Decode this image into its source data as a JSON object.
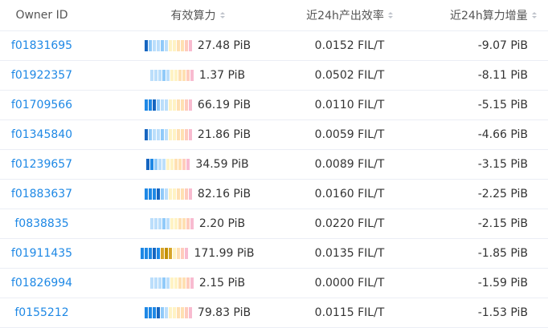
{
  "columns": {
    "owner_id": "Owner ID",
    "power": "有效算力",
    "efficiency": "近24h产出效率",
    "increase": "近24h算力增量"
  },
  "colors": {
    "link": "#1e88e5",
    "bar_palette": [
      "#1565c0",
      "#1e88e5",
      "#90caf9",
      "#bbdefb",
      "#fff3c4",
      "#ffe0b2",
      "#ffccbc",
      "#f8bbd0",
      "#e1bee7",
      "#d7a52a",
      "#c49000"
    ]
  },
  "rows": [
    {
      "owner_id": "f01831695",
      "power": "27.48 PiB",
      "efficiency": "0.0152 FIL/T",
      "increase": "-9.07 PiB",
      "bar": [
        0,
        2,
        3,
        3,
        2,
        3,
        4,
        4,
        5,
        5,
        6,
        7
      ]
    },
    {
      "owner_id": "f01922357",
      "power": "1.37 PiB",
      "efficiency": "0.0502 FIL/T",
      "increase": "-8.11 PiB",
      "bar": [
        3,
        3,
        3,
        2,
        3,
        4,
        4,
        5,
        5,
        6,
        7
      ]
    },
    {
      "owner_id": "f01709566",
      "power": "66.19 PiB",
      "efficiency": "0.0110 FIL/T",
      "increase": "-5.15 PiB",
      "bar": [
        1,
        1,
        0,
        2,
        3,
        3,
        4,
        4,
        5,
        5,
        6,
        7
      ]
    },
    {
      "owner_id": "f01345840",
      "power": "21.86 PiB",
      "efficiency": "0.0059 FIL/T",
      "increase": "-4.66 PiB",
      "bar": [
        0,
        2,
        3,
        3,
        2,
        3,
        4,
        4,
        5,
        5,
        6,
        7
      ]
    },
    {
      "owner_id": "f01239657",
      "power": "34.59 PiB",
      "efficiency": "0.0089 FIL/T",
      "increase": "-3.15 PiB",
      "bar": [
        0,
        1,
        2,
        3,
        3,
        4,
        4,
        5,
        5,
        6,
        7
      ]
    },
    {
      "owner_id": "f01883637",
      "power": "82.16 PiB",
      "efficiency": "0.0160 FIL/T",
      "increase": "-2.25 PiB",
      "bar": [
        1,
        1,
        1,
        0,
        2,
        3,
        4,
        4,
        5,
        5,
        6,
        7
      ]
    },
    {
      "owner_id": "f0838835",
      "power": "2.20 PiB",
      "efficiency": "0.0220 FIL/T",
      "increase": "-2.15 PiB",
      "bar": [
        3,
        3,
        3,
        2,
        3,
        4,
        4,
        5,
        5,
        6,
        7
      ]
    },
    {
      "owner_id": "f01911435",
      "power": "171.99 PiB",
      "efficiency": "0.0135 FIL/T",
      "increase": "-1.85 PiB",
      "bar": [
        1,
        1,
        1,
        0,
        1,
        9,
        10,
        9,
        4,
        5,
        6,
        7
      ]
    },
    {
      "owner_id": "f01826994",
      "power": "2.15 PiB",
      "efficiency": "0.0000 FIL/T",
      "increase": "-1.59 PiB",
      "bar": [
        3,
        3,
        3,
        2,
        3,
        4,
        4,
        5,
        5,
        6,
        7
      ]
    },
    {
      "owner_id": "f0155212",
      "power": "79.83 PiB",
      "efficiency": "0.0115 FIL/T",
      "increase": "-1.53 PiB",
      "bar": [
        1,
        1,
        1,
        0,
        2,
        3,
        4,
        4,
        5,
        5,
        6,
        7
      ]
    }
  ]
}
